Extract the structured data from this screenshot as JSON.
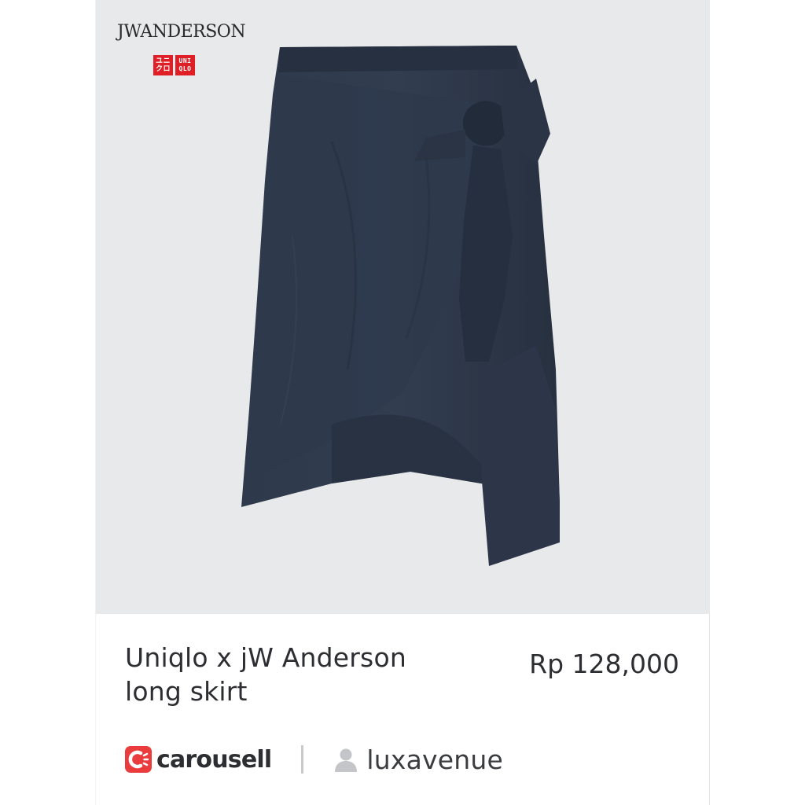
{
  "listing": {
    "title_line1": "Uniqlo x jW Anderson",
    "title_line2": "long skirt",
    "price": "Rp 128,000"
  },
  "photo": {
    "brand_logo_text": "JWANDERSON",
    "uniqlo_logo_top": "ユニ UNI",
    "uniqlo_logo_bottom": "クロ QLO",
    "product_icon": "navy-wrap-skirt-image",
    "background_color": "#e8e9eb",
    "skirt_color": "#2b3546"
  },
  "footer": {
    "platform_name": "carousell",
    "platform_icon": "carousell-logo-icon",
    "platform_color": "#ea3c3c",
    "seller_icon": "user-icon",
    "seller_name": "luxavenue"
  }
}
